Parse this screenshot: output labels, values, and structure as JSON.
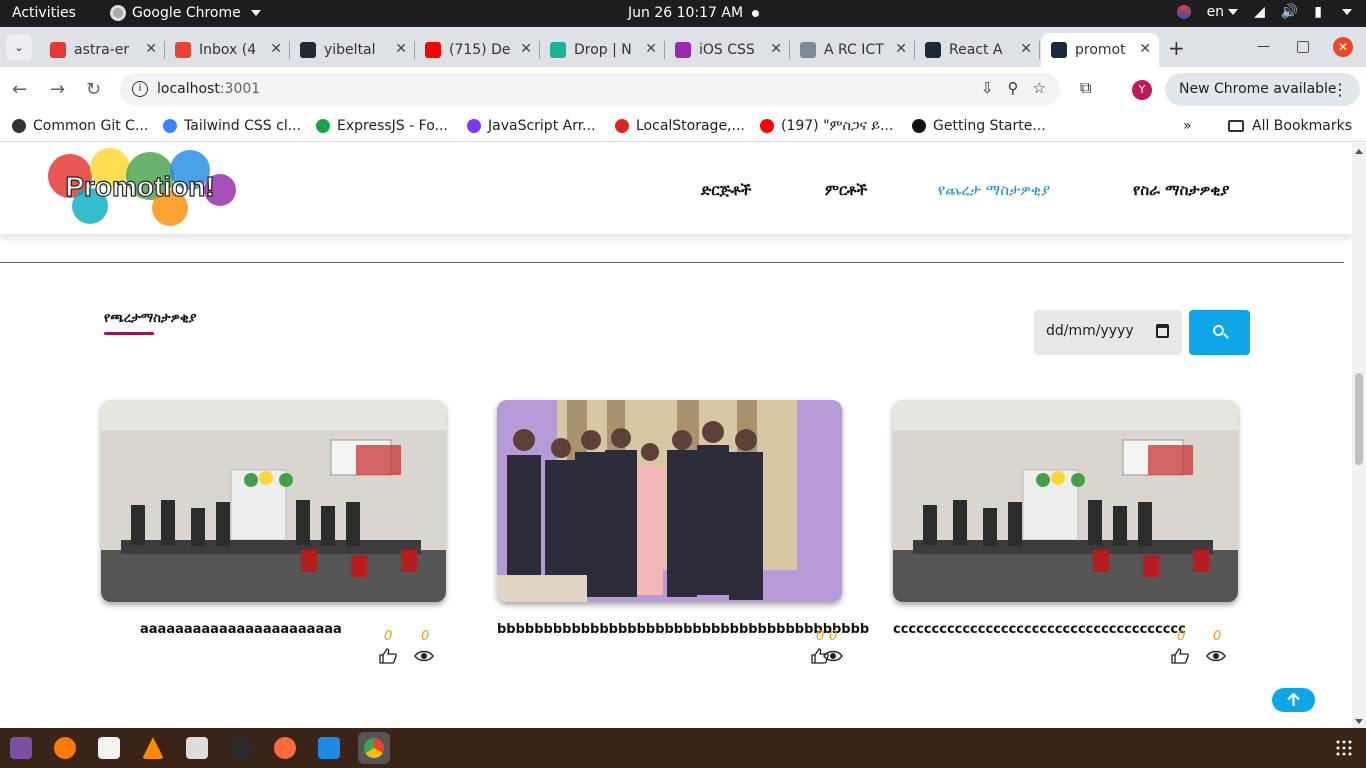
{
  "system_bar": {
    "activities": "Activities",
    "app_name": "Google Chrome",
    "clock": "Jun 26  10:17 AM",
    "language": "en"
  },
  "tabs": [
    {
      "title": "astra-er",
      "favicon_color": "#e53935"
    },
    {
      "title": "Inbox (4",
      "favicon_color": "#ea4335"
    },
    {
      "title": "yibeltal",
      "favicon_color": "#24292f"
    },
    {
      "title": "(715) De",
      "favicon_color": "#ff0000"
    },
    {
      "title": "Drop | N",
      "favicon_color": "#19b59b"
    },
    {
      "title": "iOS CSS",
      "favicon_color": "#9c27b0"
    },
    {
      "title": "A RC ICT",
      "favicon_color": "#7e8a9a"
    },
    {
      "title": "React A",
      "favicon_color": "#1b2838"
    },
    {
      "title": "promot",
      "favicon_color": "#1b2838",
      "active": true
    }
  ],
  "address_bar": {
    "host": "localhost",
    "port": ":3001"
  },
  "profile_initial": "Y",
  "update_button": "New Chrome available",
  "bookmarks": [
    {
      "label": "Common Git C...",
      "color": "#333"
    },
    {
      "label": "Tailwind CSS cl...",
      "color": "#3b82f6"
    },
    {
      "label": "ExpressJS - Fo...",
      "color": "#16a34a"
    },
    {
      "label": "JavaScript Arr...",
      "color": "#7c3aed"
    },
    {
      "label": "LocalStorage,...",
      "color": "#dc2626"
    },
    {
      "label": "(197) \"ምስጋና ይ...",
      "color": "#ff0000"
    },
    {
      "label": "Getting Starte...",
      "color": "#111"
    }
  ],
  "all_bookmarks": "All Bookmarks",
  "site": {
    "logo_text": "Promotion!",
    "nav": [
      "ድርጅቶች",
      "ምርቶች",
      "የጨረታ ማስታዎቂያ",
      "የስራ ማስታዎቂያ"
    ],
    "active_nav_index": 2,
    "accent": "#1390d8"
  },
  "section": {
    "title": "የጫረታማስታዎቂያ",
    "date_placeholder": "dd/mm/yyyy"
  },
  "cards": [
    {
      "title": "aaaaaaaaaaaaaaaaaaaaaaa",
      "likes": "0",
      "views": "0",
      "photo": "meeting-room"
    },
    {
      "title": "bbbbbbbbbbbbbbbbbbbbbbbbbbbbbbbbbbbbbbbb",
      "likes": "0",
      "views": "0",
      "photo": "group-portrait"
    },
    {
      "title": "cccccccccccccccccccccccccccccccccccccc",
      "likes": "0",
      "views": "0",
      "photo": "meeting-room"
    }
  ],
  "colors": {
    "brand_blue": "#0ea5e9",
    "underline": "#a3125a",
    "count": "#e1a41a"
  }
}
